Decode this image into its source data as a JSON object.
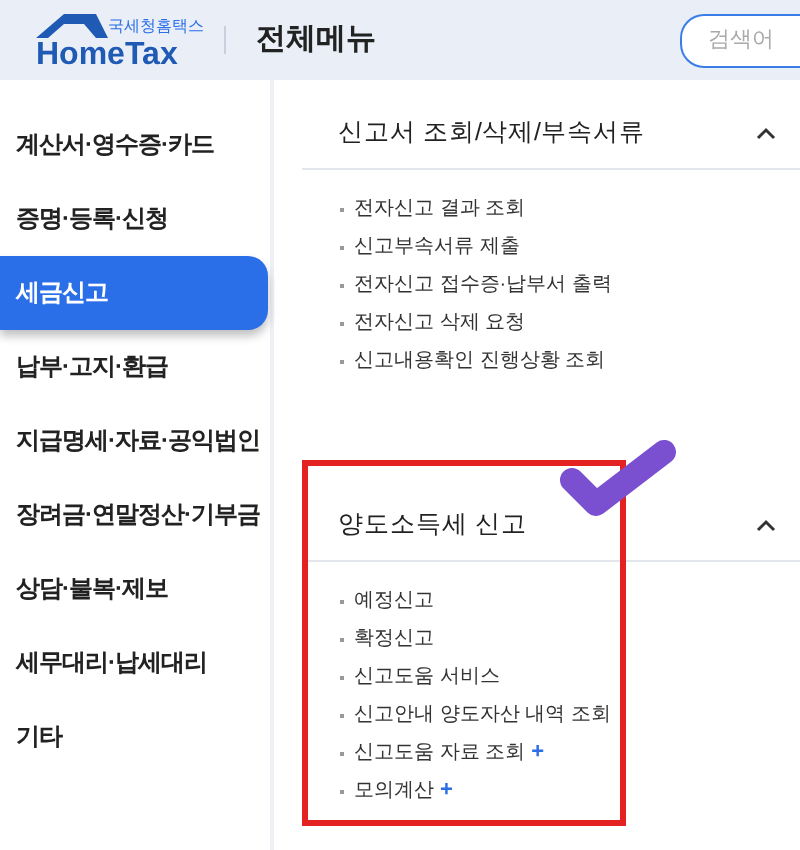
{
  "header": {
    "logo_small": "국세청홈택스",
    "logo": "HomeTax",
    "title": "전체메뉴",
    "search": {
      "placeholder": "검색어"
    }
  },
  "sidebar": {
    "items": [
      {
        "label": "계산서·영수증·카드",
        "selected": false
      },
      {
        "label": "증명·등록·신청",
        "selected": false
      },
      {
        "label": "세금신고",
        "selected": true
      },
      {
        "label": "납부·고지·환급",
        "selected": false
      },
      {
        "label": "지급명세·자료·공익법인",
        "selected": false
      },
      {
        "label": "장려금·연말정산·기부금",
        "selected": false
      },
      {
        "label": "상담·불복·제보",
        "selected": false
      },
      {
        "label": "세무대리·납세대리",
        "selected": false
      },
      {
        "label": "기타",
        "selected": false
      }
    ]
  },
  "sections": [
    {
      "title": "신고서 조회/삭제/부속서류",
      "expanded": true,
      "highlighted": false,
      "items": [
        {
          "label": "전자신고 결과 조회"
        },
        {
          "label": "신고부속서류 제출"
        },
        {
          "label": "전자신고 접수증·납부서 출력"
        },
        {
          "label": "전자신고 삭제 요청"
        },
        {
          "label": "신고내용확인 진행상황 조회"
        }
      ]
    },
    {
      "title": "양도소득세 신고",
      "expanded": true,
      "highlighted": true,
      "items": [
        {
          "label": "예정신고"
        },
        {
          "label": "확정신고"
        },
        {
          "label": "신고도움 서비스"
        },
        {
          "label": "신고안내 양도자산 내역 조회"
        },
        {
          "label": "신고도움 자료 조회",
          "more": "+"
        },
        {
          "label": "모의계산",
          "more": "+"
        }
      ]
    }
  ]
}
